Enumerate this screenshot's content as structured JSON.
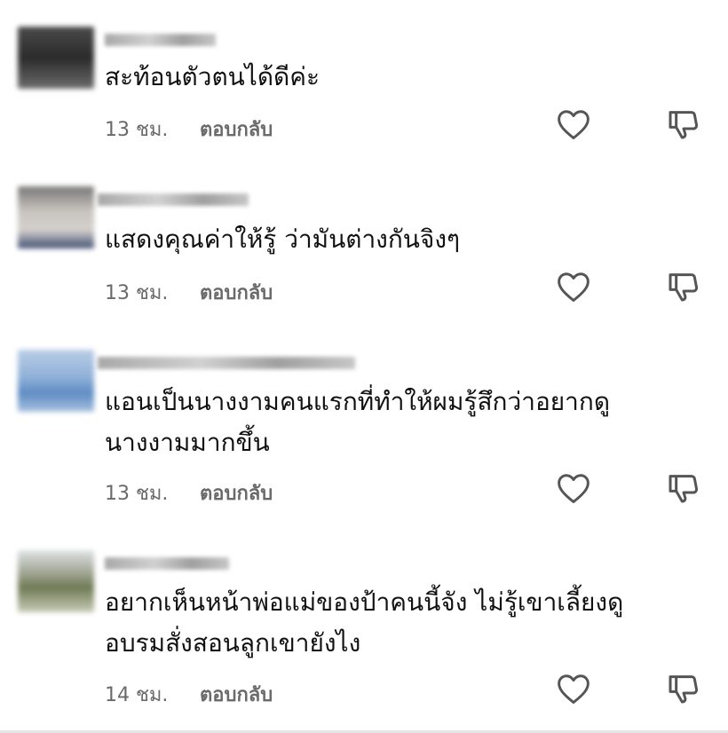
{
  "comments": [
    {
      "text_lines": [
        "สะท้อนตัวตนได้ดีค่ะ"
      ],
      "time": "13 ชม.",
      "reply": "ตอบกลับ"
    },
    {
      "text_lines": [
        "แสดงคุณค่าให้รู้ ว่ามันต่างกันจิงๆ"
      ],
      "time": "13 ชม.",
      "reply": "ตอบกลับ"
    },
    {
      "text_lines": [
        "แอนเป็นนางงามคนแรกที่ทำให้ผมรู้สึกว่าอยากดู",
        "นางงามมากขึ้น"
      ],
      "time": "13 ชม.",
      "reply": "ตอบกลับ"
    },
    {
      "text_lines": [
        "อยากเห็นหน้าพ่อแม่ของป้าคนนี้จัง ไม่รู้เขาเลี้ยงดู",
        "อบรมสั่งสอนลูกเขายังไง"
      ],
      "time": "14 ชม.",
      "reply": "ตอบกลับ"
    }
  ],
  "icons": {
    "like": "heart-outline-icon",
    "dislike": "thumbs-down-outline-icon"
  },
  "colors": {
    "text": "#111111",
    "meta": "#6a6a6a",
    "icon": "#555555"
  }
}
